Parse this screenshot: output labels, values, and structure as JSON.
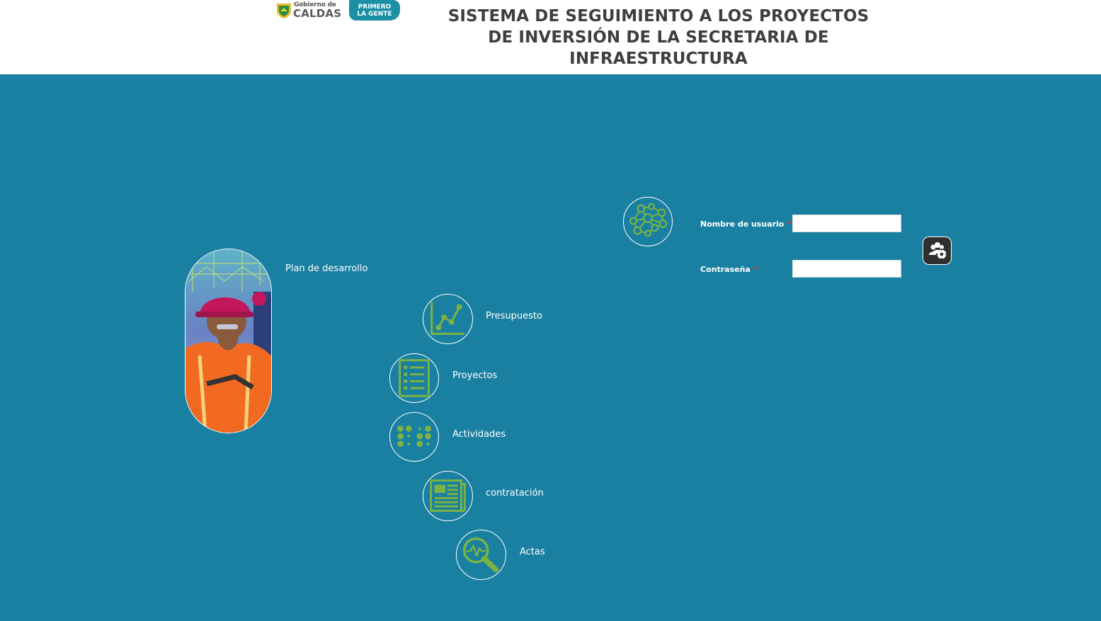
{
  "header": {
    "logo": {
      "small": "Gobierno de",
      "big": "CALDAS",
      "badge_line1": "PRIMERO",
      "badge_line2": "LA GENTE"
    },
    "title": "SISTEMA DE SEGUIMIENTO A LOS PROYECTOS DE INVERSIÓN DE LA SECRETARIA DE INFRAESTRUCTURA"
  },
  "menu": {
    "plan_label": "Plan de desarrollo",
    "items": [
      {
        "label": "Presupuesto",
        "icon": "line-chart-icon"
      },
      {
        "label": "Proyectos",
        "icon": "checklist-icon"
      },
      {
        "label": "Actividades",
        "icon": "dots-grid-icon"
      },
      {
        "label": "contratación",
        "icon": "newspaper-icon"
      },
      {
        "label": "Actas",
        "icon": "magnifier-pulse-icon"
      }
    ]
  },
  "login": {
    "network_icon": "network-icon",
    "username_label": "Nombre de usuario",
    "password_label": "Contraseña",
    "required_mark": "*",
    "username_value": "",
    "password_value": "",
    "submit_icon": "users-gear-icon"
  },
  "colors": {
    "background": "#1a80a1",
    "icon_green": "#7cb342",
    "header_bg": "#ffffff",
    "title_text": "#3e3e3e"
  }
}
